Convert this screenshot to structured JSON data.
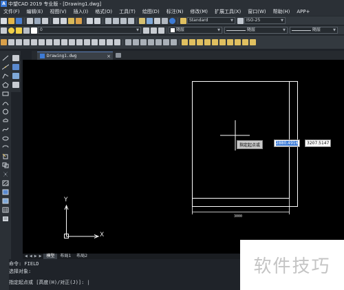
{
  "window": {
    "title": "中望CAD 2019 专业版 - [Drawing1.dwg]"
  },
  "menu": [
    {
      "label": "文件(F)"
    },
    {
      "label": "编辑(E)"
    },
    {
      "label": "视图(V)"
    },
    {
      "label": "插入(I)"
    },
    {
      "label": "格式(O)"
    },
    {
      "label": "工具(T)"
    },
    {
      "label": "绘图(D)"
    },
    {
      "label": "标注(N)"
    },
    {
      "label": "修改(M)"
    },
    {
      "label": "扩展工具(X)"
    },
    {
      "label": "窗口(W)"
    },
    {
      "label": "帮助(H)"
    },
    {
      "label": "APP+"
    }
  ],
  "toolbar": {
    "text_style": "Standard",
    "dim_style": "ISO-25",
    "layer": "0",
    "color": "随层",
    "linetype": "随层",
    "lineweight": "随层"
  },
  "document_tab": {
    "label": "Drawing1.dwg",
    "close": "×"
  },
  "canvas": {
    "dimension_value": "3000",
    "ucs_x": "X",
    "ucs_y": "Y",
    "prompt_label": "指定起点或",
    "input_value_1": "2880.4916",
    "input_value_2": "3207.5147"
  },
  "layout_tabs": [
    {
      "label": "模型"
    },
    {
      "label": "布局1"
    },
    {
      "label": "布局2"
    }
  ],
  "command_line": {
    "line1": "命令: FIELD",
    "line2": "选择对象:",
    "line3": "指定起点或 [高度(H)/对正(J)]: |"
  },
  "watermark": {
    "text": "软件技巧"
  },
  "colors": {
    "canvas_bg": "#000000",
    "ui_bg": "#2b3036",
    "accent": "#3d7bd6"
  }
}
